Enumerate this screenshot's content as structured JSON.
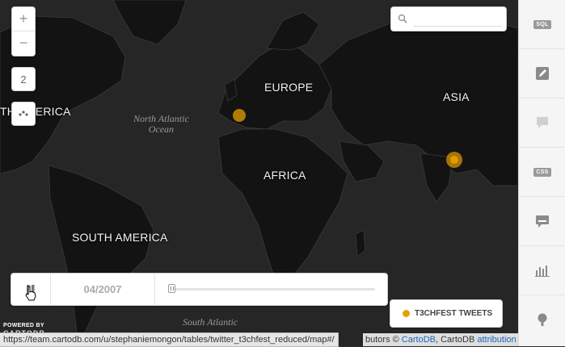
{
  "map": {
    "continents": [
      "EUROPE",
      "ASIA",
      "AFRICA",
      "SOUTH AMERICA",
      "TH AMERICA"
    ],
    "oceans": [
      "North Atlantic",
      "Ocean",
      "South Atlantic"
    ],
    "point_color": "#e6a000"
  },
  "controls": {
    "zoom_in": "+",
    "zoom_out": "−",
    "zoom_level": "2",
    "search_placeholder": ""
  },
  "sidebar": {
    "items": [
      {
        "label": "SQL",
        "icon": "sql-icon"
      },
      {
        "label": "",
        "icon": "wizard-brush-icon"
      },
      {
        "label": "",
        "icon": "infowindow-icon"
      },
      {
        "label": "CSS",
        "icon": "css-icon"
      },
      {
        "label": "",
        "icon": "legend-icon"
      },
      {
        "label": "",
        "icon": "filters-chart-icon"
      },
      {
        "label": "",
        "icon": "layer-pin-icon"
      }
    ]
  },
  "timeline": {
    "date": "04/2007",
    "progress": 0
  },
  "legend": {
    "title": "T3CHFEST TWEETS",
    "color": "#e6a000"
  },
  "footer": {
    "powered_by": "POWERED BY",
    "powered_logo": "CARTODB",
    "status_url": "https://team.cartodb.com/u/stephaniemongon/tables/twitter_t3chfest_reduced/map#/",
    "attribution_prefix": "butors © ",
    "attribution_cartodb": "CartoDB",
    "attribution_middle": ", CartoDB ",
    "attribution_link": "attribution"
  }
}
